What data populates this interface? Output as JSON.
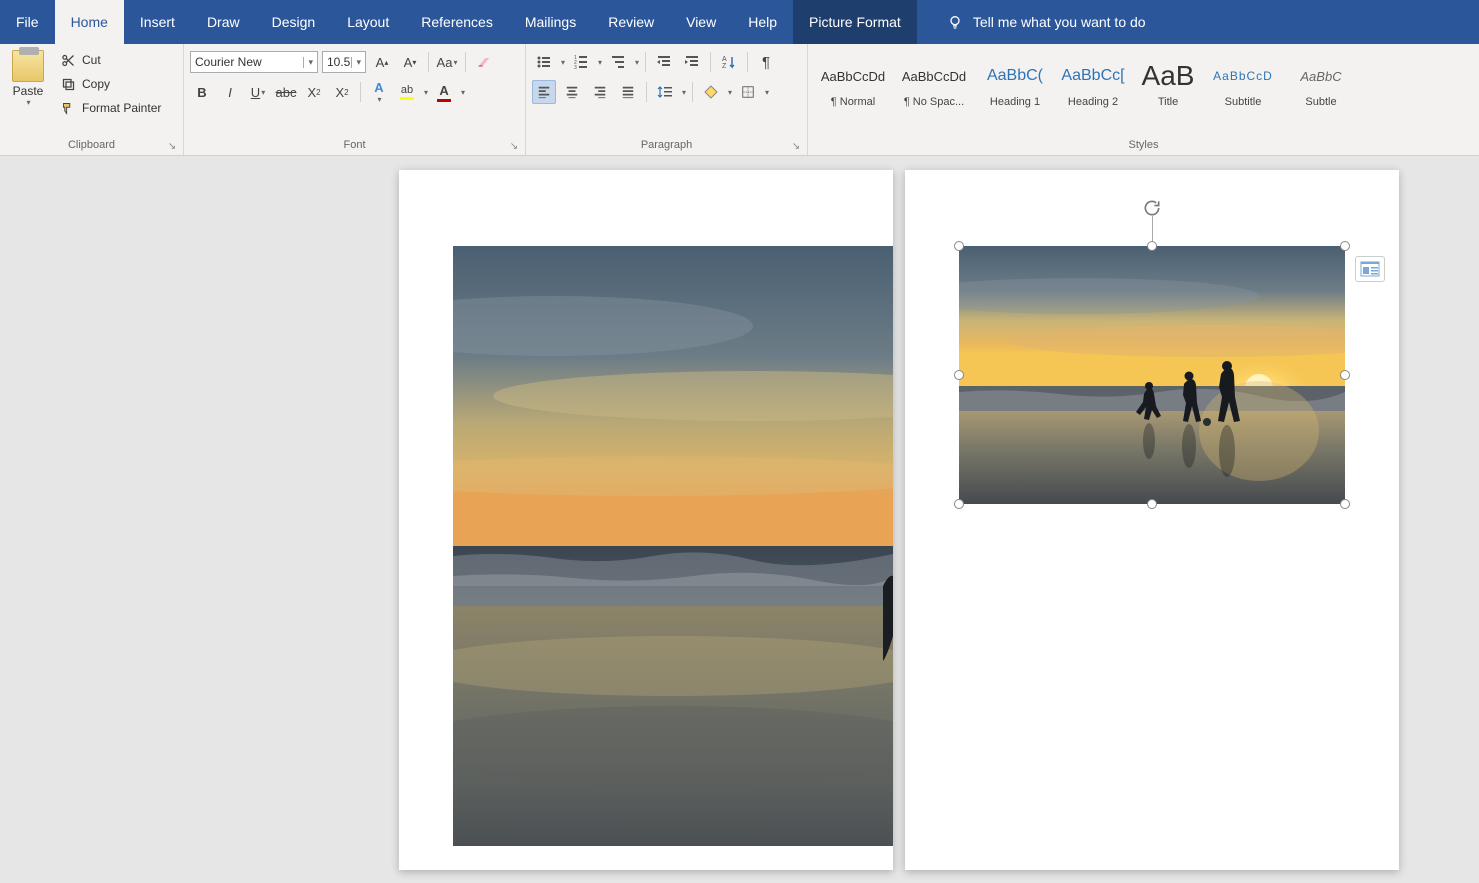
{
  "tabs": {
    "file": "File",
    "home": "Home",
    "insert": "Insert",
    "draw": "Draw",
    "design": "Design",
    "layout": "Layout",
    "references": "References",
    "mailings": "Mailings",
    "review": "Review",
    "view": "View",
    "help": "Help",
    "picture_format": "Picture Format"
  },
  "tellme_placeholder": "Tell me what you want to do",
  "clipboard": {
    "paste": "Paste",
    "cut": "Cut",
    "copy": "Copy",
    "format_painter": "Format Painter",
    "group_label": "Clipboard"
  },
  "font": {
    "name": "Courier New",
    "size": "10.5",
    "group_label": "Font"
  },
  "paragraph": {
    "group_label": "Paragraph"
  },
  "styles": {
    "group_label": "Styles",
    "items": [
      {
        "preview": "AaBbCcDd",
        "name": "¶ Normal",
        "class": ""
      },
      {
        "preview": "AaBbCcDd",
        "name": "¶ No Spac...",
        "class": ""
      },
      {
        "preview": "AaBbC(",
        "name": "Heading 1",
        "class": "heading"
      },
      {
        "preview": "AaBbCc[",
        "name": "Heading 2",
        "class": "heading"
      },
      {
        "preview": "AaB",
        "name": "Title",
        "class": "titlebig"
      },
      {
        "preview": "AaBbCcD",
        "name": "Subtitle",
        "class": "subtitle"
      },
      {
        "preview": "AaBbC",
        "name": "Subtle",
        "class": "subtle"
      }
    ]
  }
}
